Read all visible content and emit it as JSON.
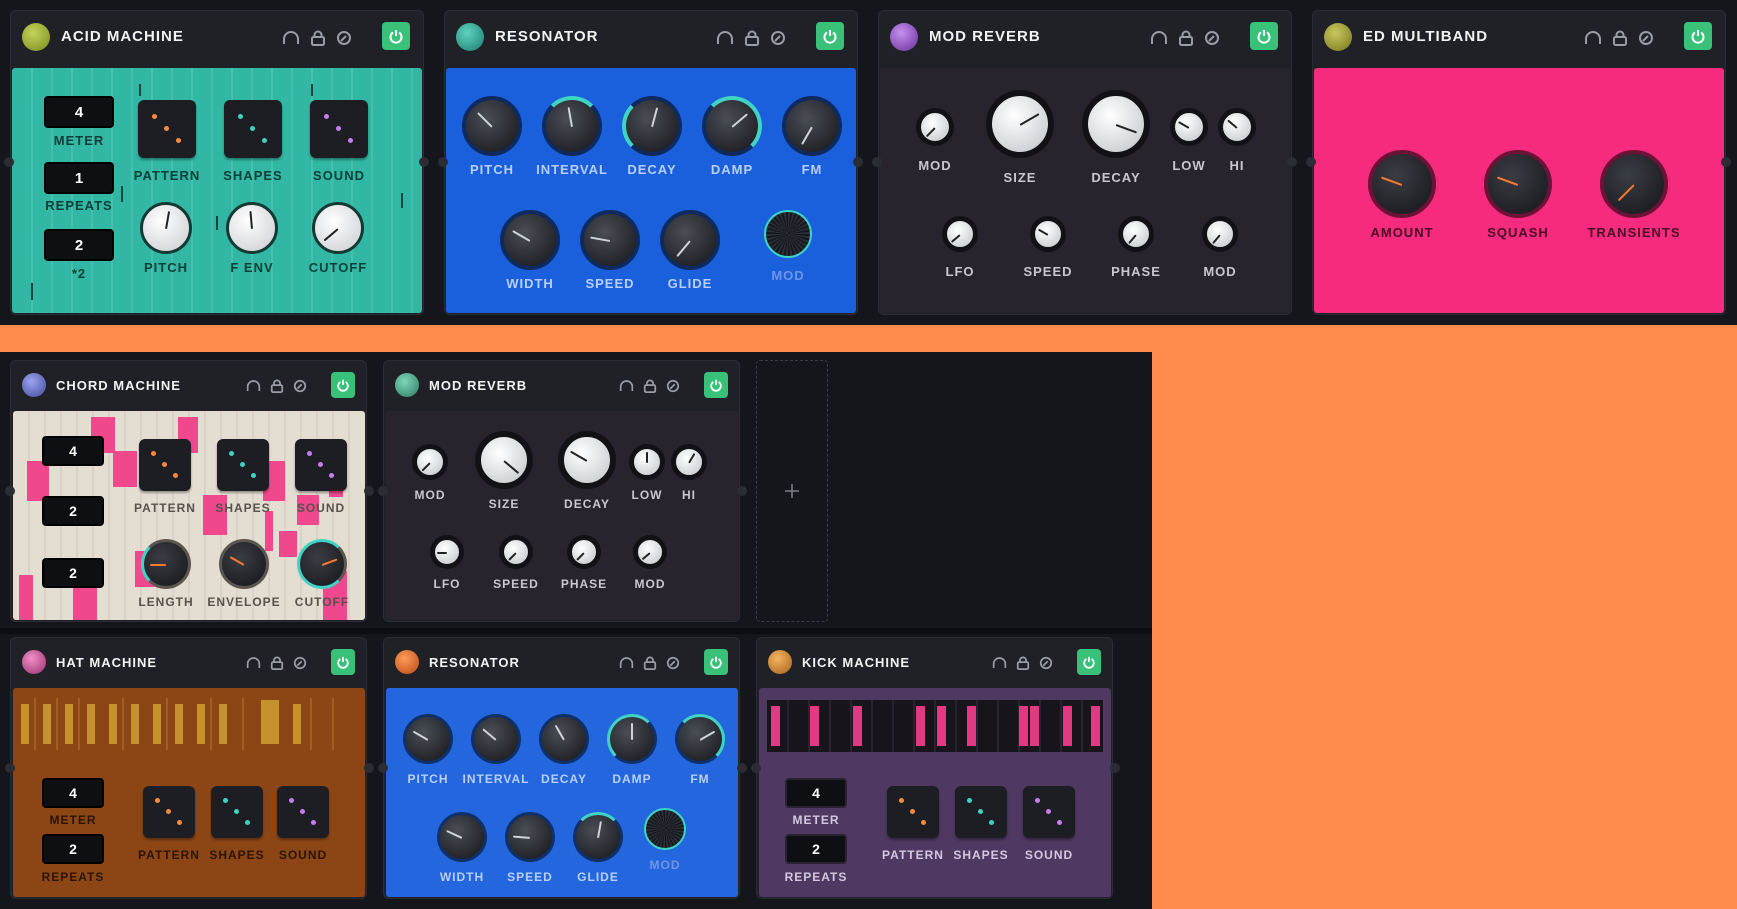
{
  "icons": {
    "headphones": "headphones-icon",
    "lock": "lock-icon",
    "clock": "clock-icon",
    "power": "power-icon",
    "plus": "plus-icon"
  },
  "colors": {
    "background": "#FE8A4C",
    "power": "#39c17a",
    "teal": "#32b7a4",
    "blue": "#1a5fdc",
    "pink": "#f62b7d",
    "dark": "#27242d",
    "cream": "#e4ddd2",
    "brown": "#8c4615",
    "purple": "#4f3862"
  },
  "acid": {
    "title": "ACID MACHINE",
    "meter": "4",
    "meter_label": "METER",
    "repeats": "1",
    "repeats_label": "REPEATS",
    "mult": "2",
    "mult_label": "*2",
    "pads": [
      "PATTERN",
      "SHAPES",
      "SOUND"
    ],
    "knobs": [
      "PITCH",
      "F ENV",
      "CUTOFF"
    ]
  },
  "res1": {
    "title": "RESONATOR",
    "row1": [
      "PITCH",
      "INTERVAL",
      "DECAY",
      "DAMP",
      "FM"
    ],
    "row2": [
      "WIDTH",
      "SPEED",
      "GLIDE",
      "MOD"
    ]
  },
  "rev1": {
    "title": "MOD REVERB",
    "row1": [
      "MOD",
      "SIZE",
      "DECAY",
      "LOW",
      "HI"
    ],
    "row2": [
      "LFO",
      "SPEED",
      "PHASE",
      "MOD"
    ]
  },
  "multi": {
    "title": "ED MULTIBAND",
    "knobs": [
      "AMOUNT",
      "SQUASH",
      "TRANSIENTS"
    ]
  },
  "chord": {
    "title": "CHORD MACHINE",
    "boxes": [
      "4",
      "2",
      "2"
    ],
    "pads": [
      "PATTERN",
      "SHAPES",
      "SOUND"
    ],
    "knobs": [
      "LENGTH",
      "ENVELOPE",
      "CUTOFF"
    ]
  },
  "rev2": {
    "title": "MOD REVERB",
    "row1": [
      "MOD",
      "SIZE",
      "DECAY",
      "LOW",
      "HI"
    ],
    "row2": [
      "LFO",
      "SPEED",
      "PHASE",
      "MOD"
    ]
  },
  "hat": {
    "title": "HAT MACHINE",
    "meter": "4",
    "meter_label": "METER",
    "repeats": "2",
    "repeats_label": "REPEATS",
    "pads": [
      "PATTERN",
      "SHAPES",
      "SOUND"
    ]
  },
  "res2": {
    "title": "RESONATOR",
    "row1": [
      "PITCH",
      "INTERVAL",
      "DECAY",
      "DAMP",
      "FM"
    ],
    "row2": [
      "WIDTH",
      "SPEED",
      "GLIDE",
      "MOD"
    ]
  },
  "kick": {
    "title": "KICK MACHINE",
    "meter": "4",
    "meter_label": "METER",
    "repeats": "2",
    "repeats_label": "REPEATS",
    "pads": [
      "PATTERN",
      "SHAPES",
      "SOUND"
    ]
  }
}
